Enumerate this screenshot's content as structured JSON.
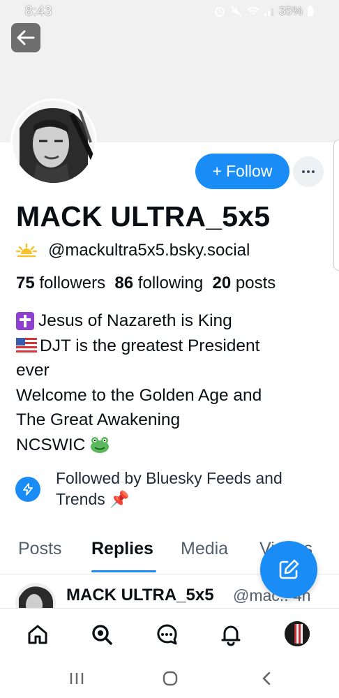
{
  "status_bar": {
    "time": "8:43",
    "battery": "35%",
    "icons": [
      "alarm-icon",
      "mute-icon",
      "wifi-icon",
      "signal-icon",
      "battery-icon"
    ]
  },
  "header": {
    "back_icon": "arrow-left-icon"
  },
  "profile": {
    "display_name": "MACK ULTRA_5x5",
    "handle_emoji": "sunrise-emoji",
    "handle": "@mackultra5x5.bsky.social",
    "stats": {
      "followers_count": "75",
      "followers_label": "followers",
      "following_count": "86",
      "following_label": "following",
      "posts_count": "20",
      "posts_label": "posts"
    },
    "bio": {
      "line1": "Jesus of Nazareth is King",
      "line2": "DJT is the greatest President",
      "line3": "ever",
      "line4": "Welcome to the Golden Age and",
      "line5": "The Great Awakening",
      "line6": "NCSWIC",
      "emoji": {
        "cross": "✝️",
        "flag": "🇺🇸",
        "frog": "🐸"
      }
    },
    "followed_by": "Followed by Bluesky Feeds and Trends",
    "followed_by_emoji": "📌"
  },
  "actions": {
    "follow_plus": "+",
    "follow_label": "Follow",
    "more_icon": "ellipsis-icon"
  },
  "tabs": [
    {
      "label": "Posts",
      "active": false
    },
    {
      "label": "Replies",
      "active": true
    },
    {
      "label": "Media",
      "active": false
    },
    {
      "label": "Videos",
      "active": false
    }
  ],
  "post_preview": {
    "author": "MACK ULTRA_5x5",
    "handle_time": "@mac.. 4h"
  },
  "compose_icon": "compose-icon",
  "bottom_nav": [
    "home-icon",
    "search-icon",
    "chat-icon",
    "bell-icon",
    "profile-avatar"
  ],
  "android_nav": [
    "recents-icon",
    "home-circle-icon",
    "back-chevron-icon"
  ],
  "colors": {
    "accent": "#1a8cf5",
    "banner": "#f1f1f1",
    "text": "#0b0f14",
    "muted": "#53606d"
  }
}
